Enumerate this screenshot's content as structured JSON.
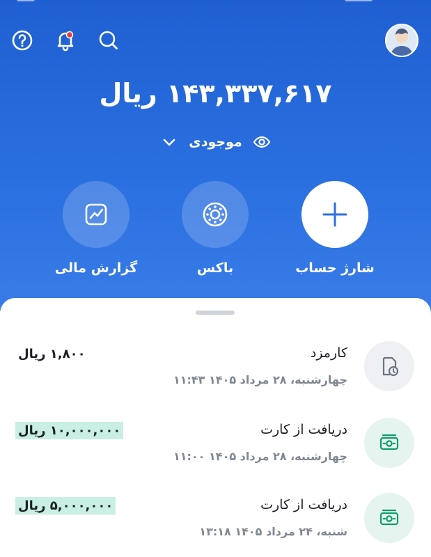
{
  "header": {
    "balance": "۱۴۳,۳۳۷,۶۱۷ ریال",
    "balance_label": "موجودی",
    "icons": [
      "help-icon",
      "notification-bell-icon",
      "search-icon",
      "avatar"
    ]
  },
  "actions": [
    {
      "label": "شارژ حساب",
      "icon": "plus-icon"
    },
    {
      "label": "باکس",
      "icon": "box-icon"
    },
    {
      "label": "گزارش مالی",
      "icon": "chart-icon"
    }
  ],
  "transactions": [
    {
      "title": "کارمزد",
      "date": "چهارشنبه، ۲۸ مرداد ۱۴۰۵ ۱۱:۴۳",
      "amount": "۱,۸۰۰ ریال",
      "icon": "receipt-clock-icon",
      "highlight": false
    },
    {
      "title": "دریافت از کارت",
      "date": "چهارشنبه، ۲۸ مرداد ۱۴۰۵ ۱۱:۰۰",
      "amount": "۱۰,۰۰۰,۰۰۰ ریال",
      "icon": "money-icon",
      "highlight": true
    },
    {
      "title": "دریافت از کارت",
      "date": "شنبه، ۲۴ مرداد ۱۴۰۵ ۱۳:۱۸",
      "amount": "۵,۰۰۰,۰۰۰ ریال",
      "icon": "money-icon",
      "highlight": true
    }
  ],
  "colors": {
    "header_blue": "#2a6fe0",
    "accent_blue": "#2f6fe4",
    "income_green": "#0f9b6c",
    "highlight_mint": "#c9efe4"
  }
}
